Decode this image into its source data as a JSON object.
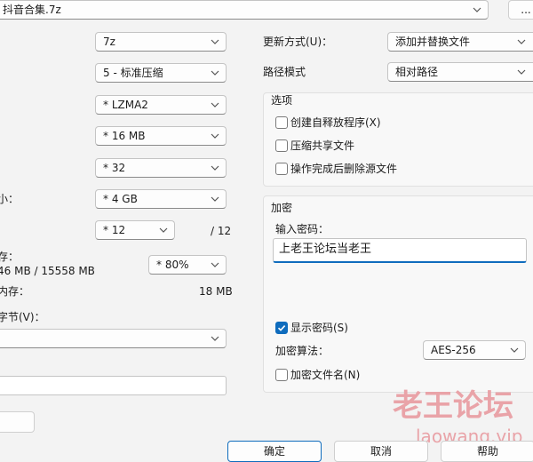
{
  "archive": {
    "name": "抖音合集.7z",
    "browse_label": "..."
  },
  "left": {
    "format": {
      "value": "7z"
    },
    "level": {
      "value": "5 - 标准压缩"
    },
    "method": {
      "value": "* LZMA2"
    },
    "dict": {
      "value": "* 16 MB"
    },
    "word": {
      "value": "* 32"
    },
    "solid": {
      "label": "小：",
      "value": "* 4 GB"
    },
    "threads": {
      "value": "* 12",
      "max": "/ 12"
    },
    "memory_compress": {
      "label": "存：",
      "value": "46 MB / 15558 MB",
      "percent": "* 80%"
    },
    "memory_decompress": {
      "label": "内存：",
      "value": "18 MB"
    },
    "split": {
      "label": "字节(V)：",
      "value": ""
    },
    "params": {
      "value": ""
    },
    "fragments": [
      "：",
      "：",
      "：",
      "："
    ]
  },
  "right": {
    "update_mode": {
      "label": "更新方式(U)：",
      "value": "添加并替换文件"
    },
    "path_mode": {
      "label": "路径模式",
      "value": "相对路径"
    },
    "options": {
      "title": "选项",
      "sfx": "创建自释放程序(X)",
      "shared": "压缩共享文件",
      "delete_after": "操作完成后删除源文件"
    },
    "encryption": {
      "title": "加密",
      "password_label": "输入密码：",
      "password_value": "上老王论坛当老王",
      "show_password": "显示密码(S)",
      "method_label": "加密算法：",
      "method_value": "AES-256",
      "encrypt_names": "加密文件名(N)"
    }
  },
  "buttons": {
    "ok": "确定",
    "cancel": "取消",
    "help": "帮助"
  },
  "watermark": {
    "cn": "老王论坛",
    "en": "laowang.vip"
  }
}
